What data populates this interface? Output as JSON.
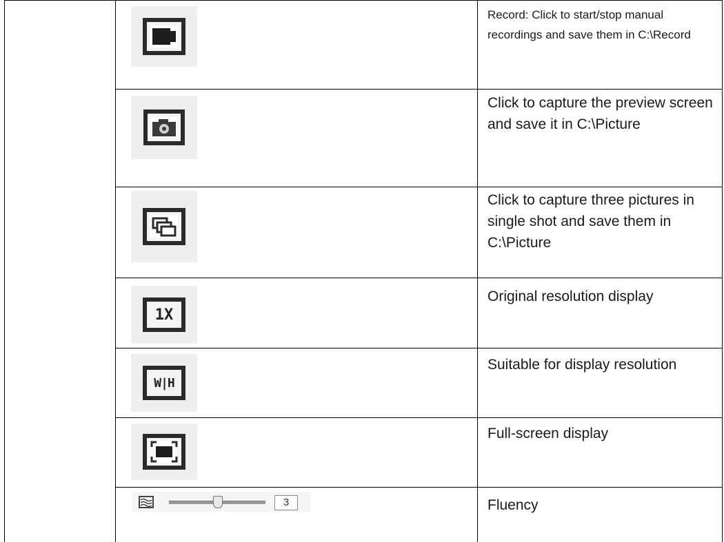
{
  "rows": [
    {
      "icon": "record-icon",
      "description": "Record: Click to start/stop manual recordings and save them in C:\\Record"
    },
    {
      "icon": "camera-icon",
      "description": "Click to capture the preview screen and save it in C:\\Picture"
    },
    {
      "icon": "multi-capture-icon",
      "description": "Click to capture three pictures in single shot and save them in C:\\Picture"
    },
    {
      "icon": "original-resolution-icon",
      "icon_text": "1X",
      "description": "Original resolution display"
    },
    {
      "icon": "fit-window-icon",
      "icon_text": "W|H",
      "description": "Suitable for display resolution"
    },
    {
      "icon": "fullscreen-icon",
      "description": "Full-screen display"
    },
    {
      "icon": "fluency-icon",
      "slider_value": "3",
      "slider_level": 0.5,
      "description": "Fluency"
    }
  ],
  "colors": {
    "border": "#000000",
    "icon_bg": "#efefef",
    "icon_dark": "#2a2a2a"
  }
}
